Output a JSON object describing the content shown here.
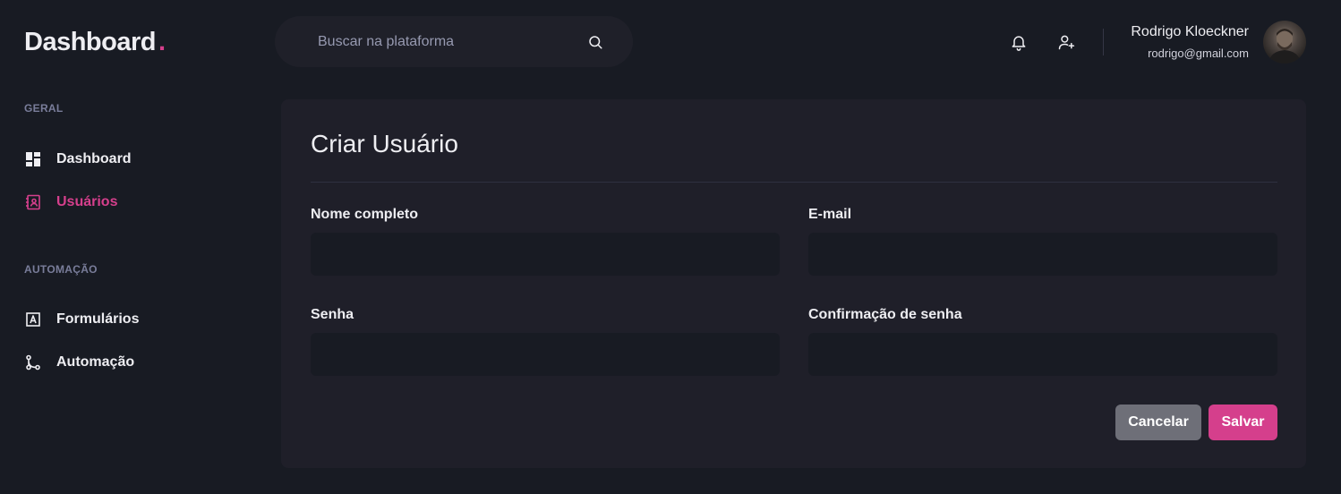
{
  "header": {
    "logo_text": "Dashboard",
    "logo_dot": ".",
    "search": {
      "placeholder": "Buscar na plataforma",
      "value": ""
    },
    "user": {
      "name": "Rodrigo Kloeckner",
      "email": "rodrigo@gmail.com"
    },
    "icons": [
      "notifications-icon",
      "add-user-icon",
      "search-icon"
    ]
  },
  "sidebar": {
    "sections": [
      {
        "title": "GERAL",
        "items": [
          {
            "label": "Dashboard",
            "icon": "dashboard-icon",
            "active": false
          },
          {
            "label": "Usuários",
            "icon": "contacts-icon",
            "active": true
          }
        ]
      },
      {
        "title": "AUTOMAÇÃO",
        "items": [
          {
            "label": "Formulários",
            "icon": "form-icon",
            "active": false
          },
          {
            "label": "Automação",
            "icon": "git-merge-icon",
            "active": false
          }
        ]
      }
    ]
  },
  "main": {
    "title": "Criar Usuário",
    "fields": {
      "name": {
        "label": "Nome completo",
        "value": ""
      },
      "email": {
        "label": "E-mail",
        "value": ""
      },
      "password": {
        "label": "Senha",
        "value": ""
      },
      "password_confirmation": {
        "label": "Confirmação de senha",
        "value": ""
      }
    },
    "actions": {
      "cancel_label": "Cancelar",
      "save_label": "Salvar"
    }
  },
  "colors": {
    "background": "#181b23",
    "card": "#1f1f29",
    "accent": "#d53f8c",
    "muted": "#797d9a",
    "cancel_button": "#6e6f78"
  }
}
